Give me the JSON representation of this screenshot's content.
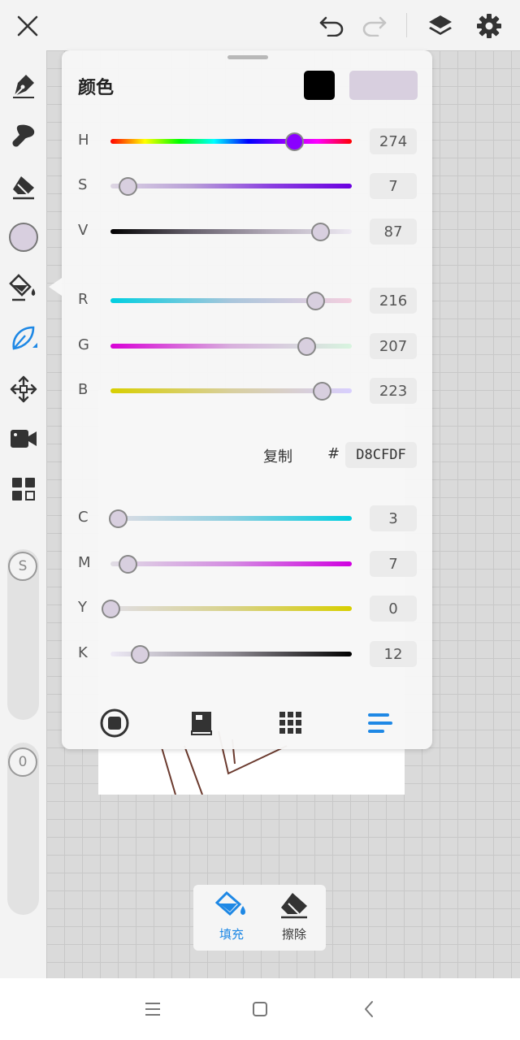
{
  "panel": {
    "title": "颜色",
    "primary_color": "#000000",
    "current_color": "#D8CFDF",
    "sliders": [
      {
        "id": "H",
        "label": "H",
        "value": "274",
        "fraction": 0.76,
        "gradient": "hue",
        "thumb_color": "#8a00ff"
      },
      {
        "id": "S",
        "label": "S",
        "value": "7",
        "fraction": 0.07,
        "gradient": "saturation",
        "thumb_color": "#d8cfdf"
      },
      {
        "id": "V",
        "label": "V",
        "value": "87",
        "fraction": 0.87,
        "gradient": "value",
        "thumb_color": "#d8cfdf"
      },
      {
        "id": "R",
        "label": "R",
        "value": "216",
        "fraction": 0.847,
        "gradient": "red",
        "thumb_color": "#d8cfdf"
      },
      {
        "id": "G",
        "label": "G",
        "value": "207",
        "fraction": 0.812,
        "gradient": "green",
        "thumb_color": "#d8cfdf"
      },
      {
        "id": "B",
        "label": "B",
        "value": "223",
        "fraction": 0.875,
        "gradient": "blue",
        "thumb_color": "#d8cfdf"
      },
      {
        "id": "C",
        "label": "C",
        "value": "3",
        "fraction": 0.03,
        "gradient": "cyan",
        "thumb_color": "#d8cfdf"
      },
      {
        "id": "M",
        "label": "M",
        "value": "7",
        "fraction": 0.07,
        "gradient": "magenta",
        "thumb_color": "#d8cfdf"
      },
      {
        "id": "Y",
        "label": "Y",
        "value": "0",
        "fraction": 0.0,
        "gradient": "yellow",
        "thumb_color": "#d8cfdf"
      },
      {
        "id": "K",
        "label": "K",
        "value": "12",
        "fraction": 0.12,
        "gradient": "black",
        "thumb_color": "#d8cfdf"
      }
    ],
    "copy_label": "复制",
    "hash_label": "#",
    "hex_value": "D8CFDF",
    "modes": [
      "wheel-mode-icon",
      "palette-book-mode-icon",
      "grid-mode-icon",
      "slider-mode-icon"
    ],
    "active_mode": "slider-mode-icon",
    "accent_color": "#1e88e5"
  },
  "fill_popup": {
    "fill_label": "填充",
    "erase_label": "擦除",
    "fill_active": true
  },
  "left_tools": {
    "track_s_label": "S",
    "track_o_label": "0",
    "active_tool": "leaf-tool-icon"
  }
}
